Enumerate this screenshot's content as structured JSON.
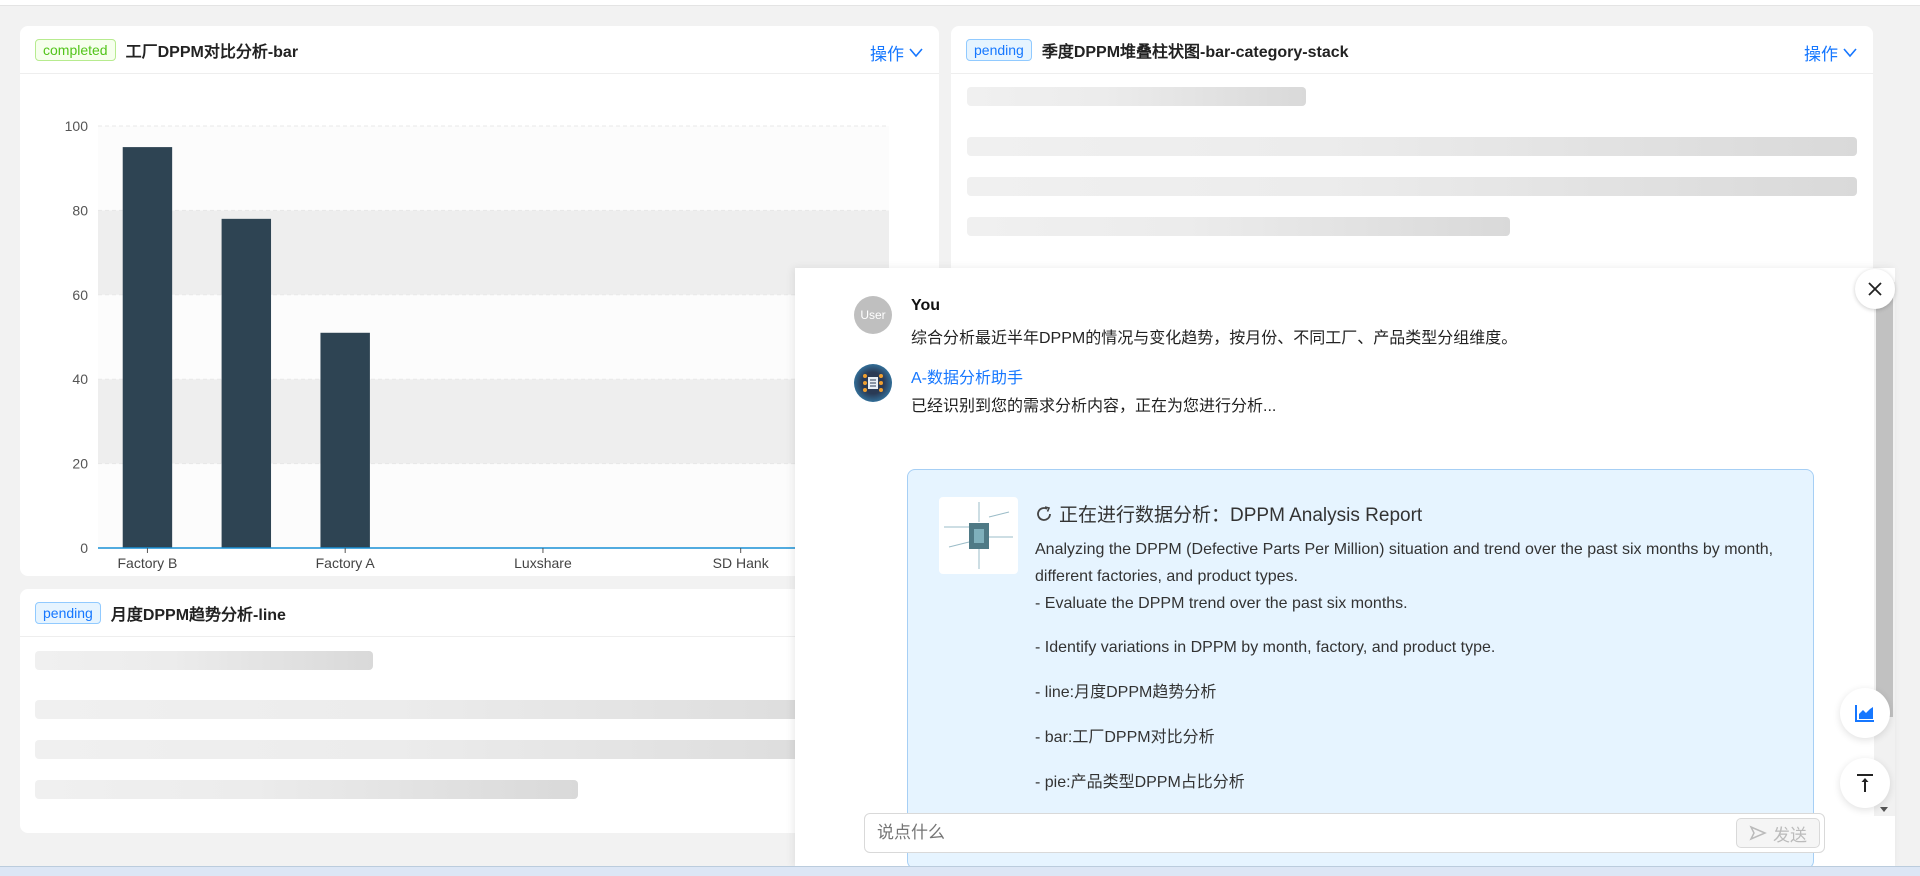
{
  "cards": [
    {
      "status": "completed",
      "title": "工厂DPPM对比分析-bar",
      "ops": "操作"
    },
    {
      "status": "pending",
      "title": "季度DPPM堆叠柱状图-bar-category-stack",
      "ops": "操作"
    },
    {
      "status": "pending",
      "title": "月度DPPM趋势分析-line"
    }
  ],
  "chart_data": {
    "type": "bar",
    "categories": [
      "Factory B",
      "",
      "Factory A",
      "",
      "Luxshare",
      "",
      "SD Hank",
      ""
    ],
    "values": [
      95,
      78,
      51,
      0,
      0,
      0,
      0,
      0
    ],
    "yticks": [
      "0",
      "20",
      "40",
      "60",
      "80",
      "100"
    ],
    "ylim": [
      0,
      100
    ],
    "bar_color": "#2e4453",
    "axis_color": "#1890d5",
    "grid": true
  },
  "chat": {
    "user_avatar": "User",
    "user_name": "You",
    "user_msg": "综合分析最近半年DPPM的情况与变化趋势，按月份、不同工厂、产品类型分组维度。",
    "bot_name": "A-数据分析助手",
    "bot_msg": "已经识别到您的需求分析内容，正在为您进行分析...",
    "report_title": "正在进行数据分析：DPPM Analysis Report",
    "report_lines": [
      "Analyzing the DPPM (Defective Parts Per Million) situation and trend over the past six months by month, different factories, and product types.",
      "- Evaluate the DPPM trend over the past six months.",
      "- Identify variations in DPPM by month, factory, and product type.",
      "- line:月度DPPM趋势分析",
      "- bar:工厂DPPM对比分析",
      "- pie:产品类型DPPM占比分析"
    ],
    "input_placeholder": "说点什么",
    "send_label": "发送"
  },
  "colors": {
    "accent": "#1677ff",
    "report_bg": "#e6f4ff"
  }
}
